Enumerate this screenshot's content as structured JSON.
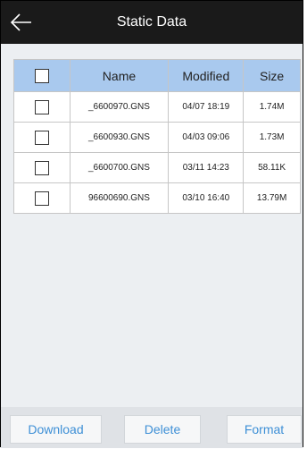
{
  "titlebar": {
    "title": "Static Data",
    "back_icon": "arrow-left-icon"
  },
  "table": {
    "columns": [
      "",
      "Name",
      "Modified",
      "Size"
    ],
    "rows": [
      {
        "name": "_6600970.GNS",
        "modified": "04/07 18:19",
        "size": "1.74M",
        "checked": false
      },
      {
        "name": "_6600930.GNS",
        "modified": "04/03 09:06",
        "size": "1.73M",
        "checked": false
      },
      {
        "name": "_6600700.GNS",
        "modified": "03/11 14:23",
        "size": "58.11K",
        "checked": false
      },
      {
        "name": "96600690.GNS",
        "modified": "03/10 16:40",
        "size": "13.79M",
        "checked": false
      }
    ]
  },
  "actions": {
    "download": "Download",
    "delete": "Delete",
    "format": "Format"
  },
  "colors": {
    "titlebar_bg": "#1a1a1a",
    "header_bg": "#a9c9ee",
    "button_text": "#3d8fd6",
    "content_bg": "#eceff2"
  }
}
